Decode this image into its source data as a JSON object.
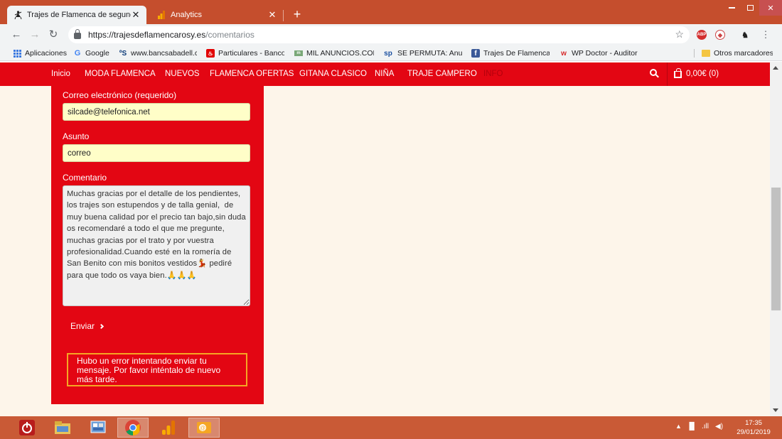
{
  "browser": {
    "tabs": [
      {
        "title": "Trajes de Flamenca de segunda m",
        "active": true,
        "icon": "dancer-icon"
      },
      {
        "title": "Analytics",
        "active": false,
        "icon": "analytics-icon"
      }
    ],
    "new_tab_label": "+",
    "url": {
      "host": "https://trajesdeflamencarosy.es",
      "path": "/comentarios"
    },
    "bookmarks": [
      {
        "label": "Aplicaciones",
        "icon": "apps-grid-icon"
      },
      {
        "label": "Google",
        "icon": "google-icon"
      },
      {
        "label": "www.bancsabadell.co",
        "icon": "bancsabadell-icon"
      },
      {
        "label": "Particulares - Banco S",
        "icon": "santander-icon"
      },
      {
        "label": "MIL ANUNCIOS.COM",
        "icon": "milanuncios-icon"
      },
      {
        "label": "SE PERMUTA: Anunci",
        "icon": "sepermuta-icon"
      },
      {
        "label": "Trajes De Flamenca",
        "icon": "facebook-icon"
      },
      {
        "label": "WP Doctor - Auditor",
        "icon": "wp-doctor-icon"
      }
    ],
    "other_bookmarks": "Otros marcadores"
  },
  "site_nav": {
    "items": [
      "Inicio",
      "MODA FLAMENCA",
      "NUEVOS",
      "FLAMENCA OFERTAS",
      "GITANA CLASICO",
      "NIÑA",
      "TRAJE CAMPERO",
      "INFO"
    ],
    "cart": "0,00€ (0)"
  },
  "form": {
    "email_label": "Correo electrónico (requerido)",
    "email_value": "silcade@telefonica.net",
    "subject_label": "Asunto",
    "subject_value": "correo",
    "comment_label": "Comentario",
    "comment_value": "Muchas gracias por el detalle de los pendientes, los trajes son estupendos y de talla genial,  de muy buena calidad por el precio tan bajo,sin duda os recomendaré a todo el que me pregunte, muchas gracias por el trato y por vuestra profesionalidad.Cuando esté en la romería de San Benito con mis bonitos vestidos💃 pediré para que todo os vaya bien.🙏🙏🙏",
    "send_label": "Enviar",
    "error_message": "Hubo un error intentando enviar tu mensaje. Por favor inténtalo de nuevo más tarde."
  },
  "taskbar": {
    "time": "17:35",
    "date": "29/01/2019"
  },
  "colors": {
    "chrome_frame": "#c54e2d",
    "site_red": "#e30613",
    "page_bg": "#fdf5ea",
    "input_bg": "#fffec8",
    "error_border": "#f5a623",
    "taskbar": "#c95a36"
  }
}
